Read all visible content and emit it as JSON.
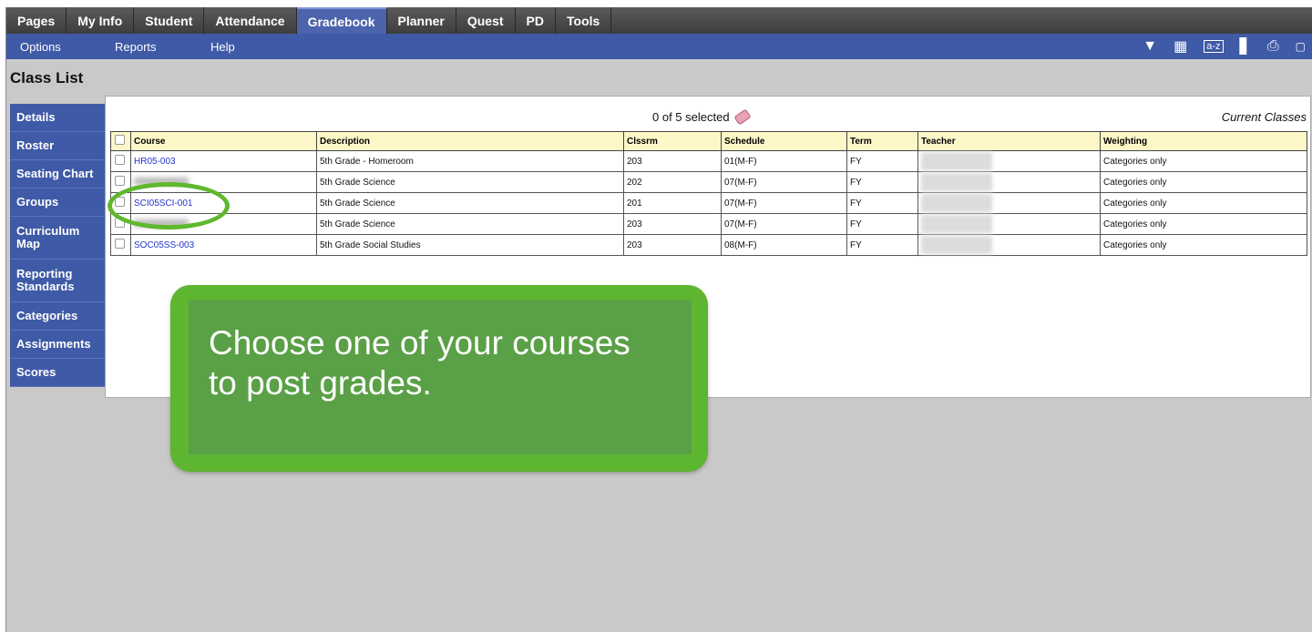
{
  "top_tabs": [
    "Pages",
    "My Info",
    "Student",
    "Attendance",
    "Gradebook",
    "Planner",
    "Quest",
    "PD",
    "Tools"
  ],
  "active_tab": "Gradebook",
  "sub_menu": [
    "Options",
    "Reports",
    "Help"
  ],
  "toolbar_icons": [
    "filter-icon",
    "grid-icon",
    "sort-az-icon",
    "chart-icon",
    "print-icon",
    "expand-icon"
  ],
  "page_title": "Class List",
  "side_nav": [
    "Details",
    "Roster",
    "Seating Chart",
    "Groups",
    "Curriculum Map",
    "Reporting Standards",
    "Categories",
    "Assignments",
    "Scores"
  ],
  "selection_text": "0 of 5 selected",
  "current_classes": "Current Classes",
  "columns": [
    "Course",
    "Description",
    "Clssrm",
    "Schedule",
    "Term",
    "Teacher",
    "Weighting"
  ],
  "rows": [
    {
      "course": "HR05-003",
      "description": "5th Grade - Homeroom",
      "room": "203",
      "schedule": "01(M-F)",
      "term": "FY",
      "weighting": "Categories only"
    },
    {
      "course": "",
      "description": "5th Grade Science",
      "room": "202",
      "schedule": "07(M-F)",
      "term": "FY",
      "weighting": "Categories only"
    },
    {
      "course": "SCI05SCI-001",
      "description": "5th Grade Science",
      "room": "201",
      "schedule": "07(M-F)",
      "term": "FY",
      "weighting": "Categories only"
    },
    {
      "course": "",
      "description": "5th Grade Science",
      "room": "203",
      "schedule": "07(M-F)",
      "term": "FY",
      "weighting": "Categories only"
    },
    {
      "course": "SOC05SS-003",
      "description": "5th Grade Social Studies",
      "room": "203",
      "schedule": "08(M-F)",
      "term": "FY",
      "weighting": "Categories only"
    }
  ],
  "callout_text": "Choose one of your courses to post grades.",
  "colors": {
    "nav_blue": "#3f5aa6",
    "callout_green": "#5eb52f",
    "header_yellow": "#fdf7c8"
  }
}
